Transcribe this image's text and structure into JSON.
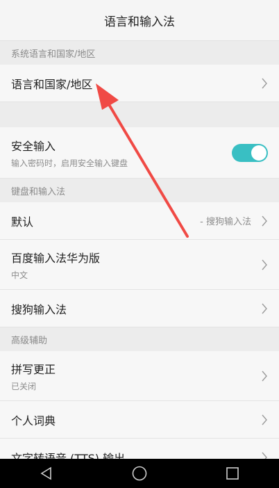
{
  "header": {
    "title": "语言和输入法"
  },
  "sections": {
    "lang_header": "系统语言和国家/地区",
    "keyboard_header": "键盘和输入法",
    "advanced_header": "高级辅助"
  },
  "rows": {
    "language_region": {
      "title": "语言和国家/地区"
    },
    "secure_input": {
      "title": "安全输入",
      "subtitle": "输入密码时，启用安全输入键盘",
      "enabled": true
    },
    "default": {
      "title": "默认",
      "value": "- 搜狗输入法"
    },
    "baidu": {
      "title": "百度输入法华为版",
      "subtitle": "中文"
    },
    "sogou": {
      "title": "搜狗输入法"
    },
    "spell": {
      "title": "拼写更正",
      "subtitle": "已关闭"
    },
    "dictionary": {
      "title": "个人词典"
    },
    "tts": {
      "title": "文字转语音 (TTS) 输出"
    }
  },
  "colors": {
    "toggle_on": "#39bfc3",
    "annotation_arrow": "#f04a45"
  },
  "icons": {
    "chevron": "chevron-right-icon",
    "back": "back-icon",
    "home": "home-icon",
    "recents": "recents-icon"
  }
}
